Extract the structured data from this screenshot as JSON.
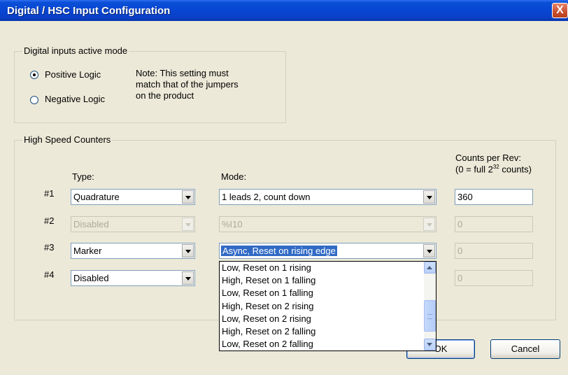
{
  "window": {
    "title": "Digital / HSC Input Configuration",
    "close_glyph": "X"
  },
  "digital_group": {
    "legend": "Digital inputs active mode",
    "options": [
      {
        "label": "Positive Logic",
        "selected": true
      },
      {
        "label": "Negative Logic",
        "selected": false
      }
    ],
    "note_lines": [
      "Note: This setting must",
      "match that of the jumpers",
      "on the product"
    ]
  },
  "hsc_group": {
    "legend": "High Speed Counters",
    "type_header": "Type:",
    "mode_header": "Mode:",
    "counts_header_line1": "Counts per Rev:",
    "counts_header_prefix": "(0 = full 2",
    "counts_header_sup": "32",
    "counts_header_suffix": " counts)",
    "rows": [
      {
        "id": "#1",
        "type": "Quadrature",
        "mode": "1 leads 2, count down",
        "counts": "360",
        "enabled": true
      },
      {
        "id": "#2",
        "type": "Disabled",
        "mode": "%I10",
        "counts": "0",
        "enabled": false
      },
      {
        "id": "#3",
        "type": "Marker",
        "mode": "Async, Reset on rising edge",
        "counts": "0",
        "enabled": true
      },
      {
        "id": "#4",
        "type": "Disabled",
        "mode": "",
        "counts": "0",
        "enabled": true
      }
    ]
  },
  "mode_dropdown": {
    "items": [
      "Low, Reset on 1 rising",
      "High, Reset on 1 falling",
      "Low, Reset on 1 falling",
      "High, Reset on 2 rising",
      "Low, Reset on 2 rising",
      "High, Reset on 2 falling",
      "Low, Reset on 2 falling"
    ]
  },
  "buttons": {
    "ok": "OK",
    "cancel": "Cancel"
  },
  "colors": {
    "titlebar": "#0a4fd6",
    "face": "#ece9d8",
    "selection": "#316ac5"
  }
}
